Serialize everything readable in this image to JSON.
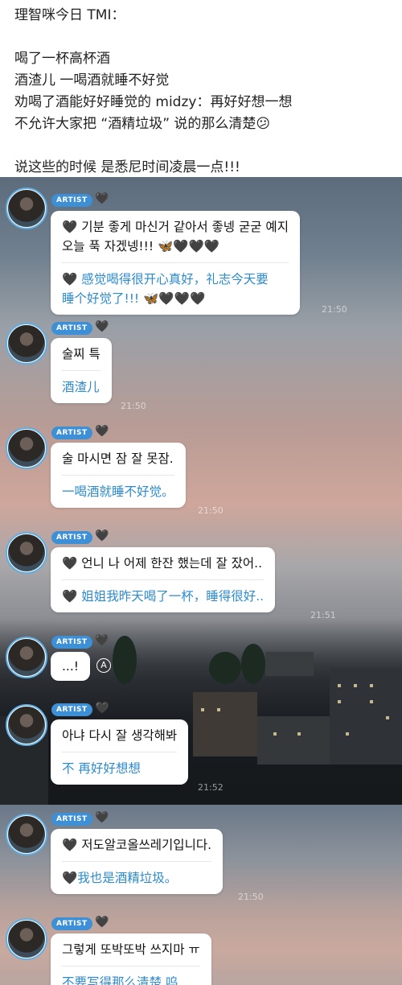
{
  "post": {
    "lines": [
      "理智咪今日 TMI：",
      "",
      "喝了一杯高杯酒",
      "酒渣儿 一喝酒就睡不好觉",
      "劝喝了酒能好好睡觉的 midzy：再好好想一想",
      "不允许大家把 “酒精垃圾” 说的那么清楚😕",
      "",
      "说这些的时候 是悉尼时间凌晨一点!!!"
    ]
  },
  "badge_label": "ARTIST",
  "messages": [
    {
      "kr": [
        "🖤 기분 좋게 마신거 같아서 좋넹 굳굳 예지",
        "오늘 푹 자겠넹!!! 🦋🖤🖤🖤"
      ],
      "cn": [
        "🖤 感觉喝得很开心真好，礼志今天要",
        "睡个好觉了!!! 🦋🖤🖤🖤"
      ],
      "time": "21:50"
    },
    {
      "kr": [
        "술찌 특"
      ],
      "cn": [
        "酒渣儿"
      ],
      "time": "21:50"
    },
    {
      "kr": [
        "술 마시면 잠 잘 못잠."
      ],
      "cn": [
        "一喝酒就睡不好觉。"
      ],
      "time": "21:50"
    },
    {
      "kr": [
        "🖤 언니 나 어제 한잔 했는데 잘 잤어.."
      ],
      "cn": [
        "🖤 姐姐我昨天喝了一杯，睡得很好.."
      ],
      "time": "21:51"
    },
    {
      "kr": [
        "...!"
      ],
      "cn": [],
      "time": ""
    },
    {
      "kr": [
        "아냐 다시 잘 생각해봐"
      ],
      "cn": [
        "不 再好好想想"
      ],
      "time": "21:52"
    },
    {
      "kr": [
        "🖤 저도알코올쓰레기입니다."
      ],
      "cn": [
        "🖤我也是酒精垃圾。"
      ],
      "time": "21:50"
    },
    {
      "kr": [
        "그렇게 또박또박 쓰지마 ㅠ"
      ],
      "cn": [
        "不要写得那么清楚 呜"
      ],
      "time": ""
    }
  ],
  "icons": {
    "badge_heart": "black-heart-icon",
    "reply": "reply-icon"
  },
  "colors": {
    "artist_badge": "#3d8fd6",
    "translation_text": "#2c8bd0",
    "avatar_ring": "#5fb0e8"
  }
}
